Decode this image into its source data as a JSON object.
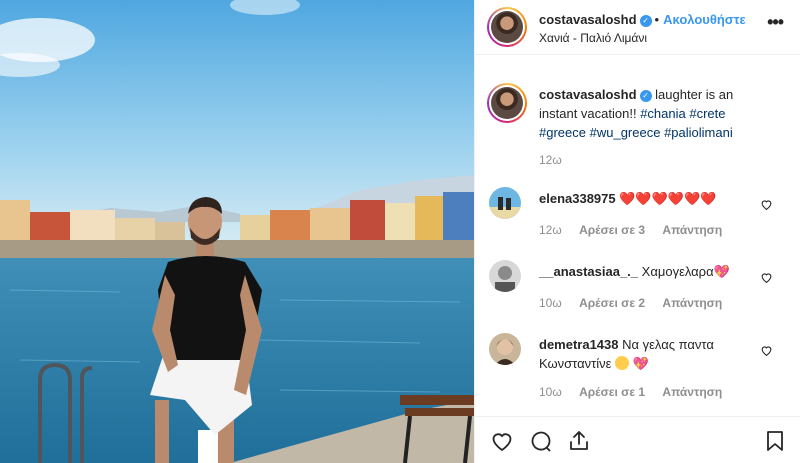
{
  "post": {
    "username": "costavasaloshd",
    "verified_glyph": "✓",
    "separator": "•",
    "follow_label": "Ακολουθήστε",
    "location": "Χανιά - Παλιό Λιμάνι",
    "more_label": "•••",
    "caption": {
      "text_before": "laughter is an instant vacation!!",
      "hashtags": [
        "#chania",
        "#crete",
        "#greece",
        "#wu_greece",
        "#paliolimani"
      ],
      "time": "12ω"
    }
  },
  "comments": [
    {
      "username": "elena338975",
      "text": "",
      "hearts": "❤️❤️❤️❤️❤️❤️",
      "time": "12ω",
      "likes": "Αρέσει σε 3",
      "reply": "Απάντηση"
    },
    {
      "username": "__anastasiaa_._",
      "text": "Χαμογελαρα",
      "hearts": "💖",
      "time": "10ω",
      "likes": "Αρέσει σε 2",
      "reply": "Απάντηση"
    },
    {
      "username": "demetra1438",
      "text": "Να γελας παντα Κωνσταντίνε",
      "hearts": "💖",
      "time": "10ω",
      "likes": "Αρέσει σε 1",
      "reply": "Απάντηση"
    }
  ],
  "icons": [
    "heart-icon",
    "comment-icon",
    "share-icon",
    "bookmark-icon",
    "more-options-icon",
    "verified-icon"
  ],
  "colors": {
    "link": "#3897f0",
    "hashtag": "#003569",
    "muted": "#8e8e8e",
    "heart": "#e0245e"
  }
}
